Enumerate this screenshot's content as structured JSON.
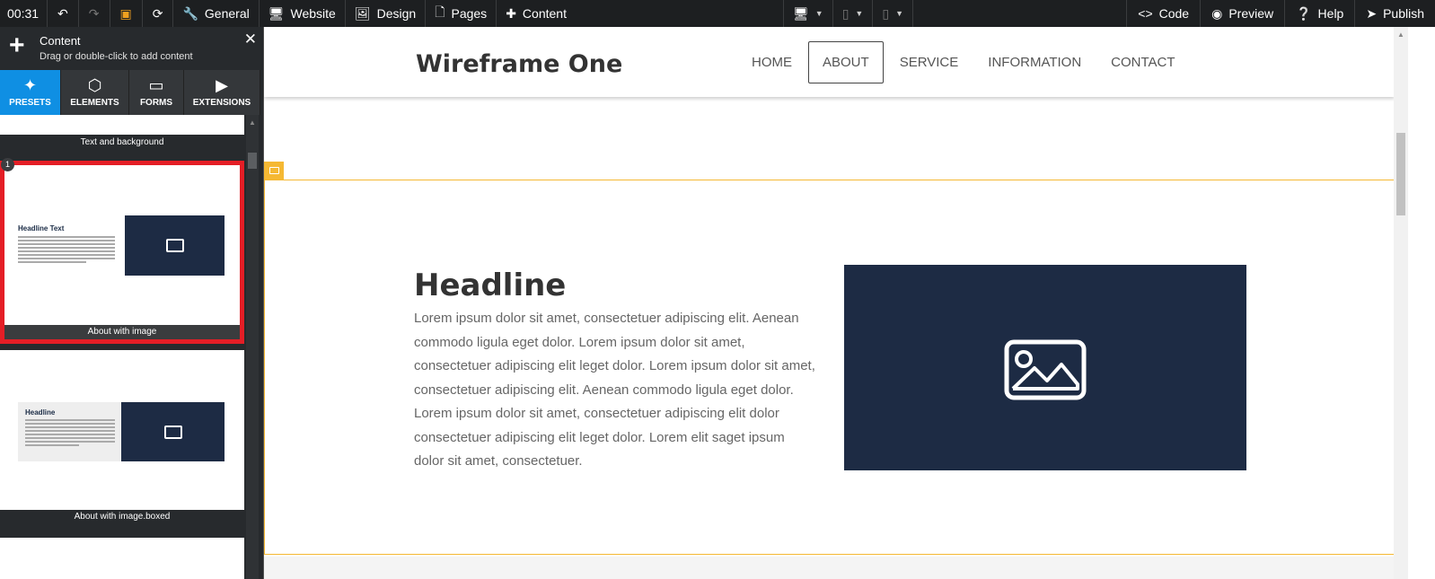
{
  "toolbar": {
    "time": "00:31",
    "menu": [
      "General",
      "Website",
      "Design",
      "Pages",
      "Content"
    ],
    "right": [
      "Code",
      "Preview",
      "Help",
      "Publish"
    ]
  },
  "panel": {
    "title": "Content",
    "subtitle": "Drag or double-click to add content",
    "tabs": [
      "PRESETS",
      "ELEMENTS",
      "FORMS",
      "EXTENSIONS"
    ],
    "presets": [
      {
        "label": "Text and background"
      },
      {
        "label": "About with image",
        "preview_headline": "Headline Text",
        "badge": "1"
      },
      {
        "label": "About with image.boxed",
        "preview_headline": "Headline"
      }
    ]
  },
  "site": {
    "logo": "Wireframe One",
    "nav": [
      "HOME",
      "ABOUT",
      "SERVICE",
      "INFORMATION",
      "CONTACT"
    ],
    "active_nav": "ABOUT",
    "headline": "Headline",
    "body": "Lorem ipsum dolor sit amet, consectetuer adipiscing elit. Aenean commodo ligula eget dolor. Lorem ipsum dolor sit amet, consectetuer adipiscing elit leget dolor. Lorem ipsum dolor sit amet, consectetuer adipiscing elit. Aenean commodo ligula eget dolor. Lorem ipsum dolor sit amet, consectetuer adipiscing elit dolor consectetuer adipiscing elit leget dolor. Lorem elit saget ipsum dolor sit amet, consectetuer."
  },
  "colors": {
    "accent": "#0f8fe3",
    "selection": "#e41e26",
    "section_outline": "#f5b833",
    "image_bg": "#1d2b44"
  }
}
